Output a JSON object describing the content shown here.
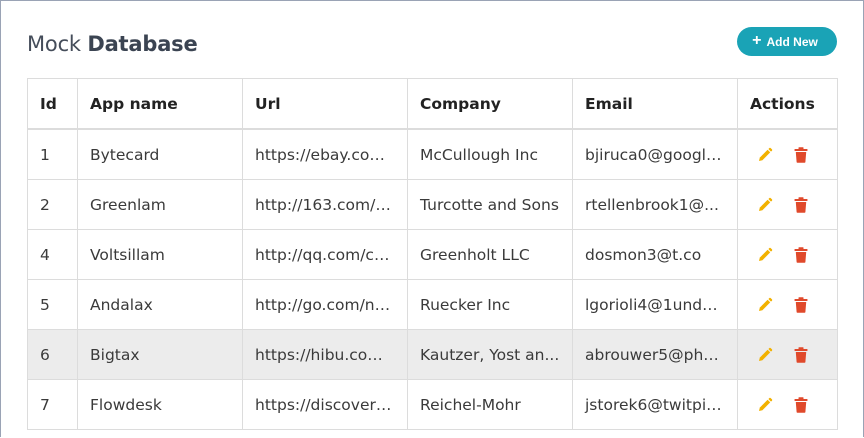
{
  "header": {
    "title_light": "Mock ",
    "title_bold": "Database",
    "add_button": "Add New",
    "add_icon": "+"
  },
  "table": {
    "columns": [
      "Id",
      "App name",
      "Url",
      "Company",
      "Email",
      "Actions"
    ],
    "rows": [
      {
        "id": "1",
        "app": "Bytecard",
        "url": "https://ebay.com...",
        "company": "McCullough Inc",
        "email": "bjiruca0@google..."
      },
      {
        "id": "2",
        "app": "Greenlam",
        "url": "http://163.com/a...",
        "company": "Turcotte and Sons",
        "email": "rtellenbrook1@..."
      },
      {
        "id": "4",
        "app": "Voltsillam",
        "url": "http://qq.com/cu...",
        "company": "Greenholt LLC",
        "email": "dosmon3@t.co"
      },
      {
        "id": "5",
        "app": "Andalax",
        "url": "http://go.com/no...",
        "company": "Ruecker Inc",
        "email": "lgorioli4@1und1...."
      },
      {
        "id": "6",
        "app": "Bigtax",
        "url": "https://hibu.com...",
        "company": "Kautzer, Yost an...",
        "email": "abrouwer5@pho..."
      },
      {
        "id": "7",
        "app": "Flowdesk",
        "url": "https://discovery...",
        "company": "Reichel-Mohr",
        "email": "jstorek6@twitpic..."
      }
    ],
    "highlighted_row_id": "6"
  },
  "colors": {
    "accent": "#1aa3b6",
    "edit_icon": "#f2b100",
    "delete_icon": "#e0492b",
    "row_highlight": "#ececec"
  },
  "icons": {
    "edit": "pencil-icon",
    "delete": "trash-icon"
  }
}
